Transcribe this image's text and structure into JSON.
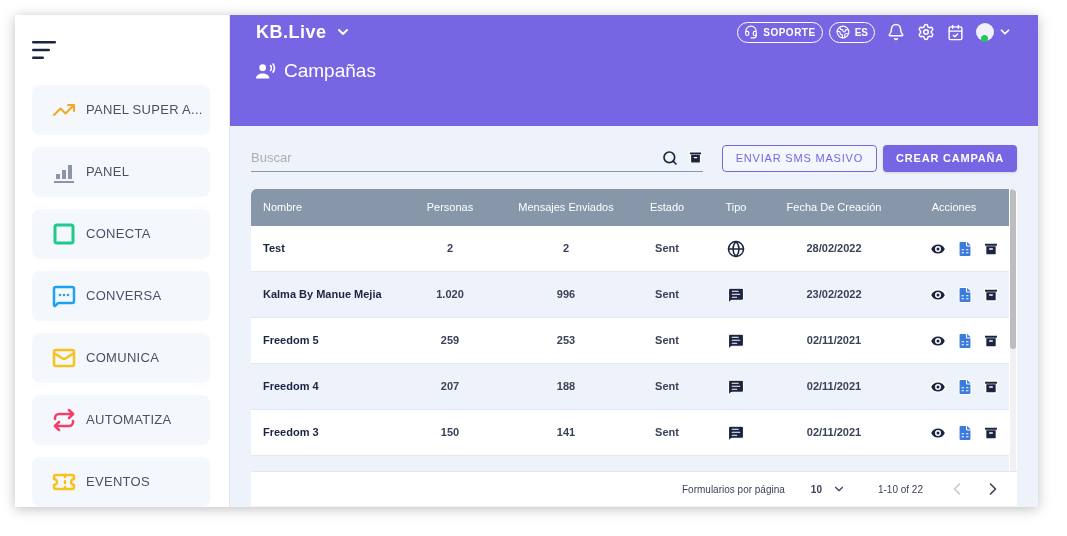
{
  "sidebar": {
    "items": [
      {
        "label": "PANEL SUPER A...",
        "kind": "trend"
      },
      {
        "label": "PANEL",
        "kind": "bars"
      },
      {
        "label": "CONECTA",
        "kind": "connect"
      },
      {
        "label": "CONVERSA",
        "kind": "chat"
      },
      {
        "label": "COMUNICA",
        "kind": "mail"
      },
      {
        "label": "AUTOMATIZA",
        "kind": "automate"
      },
      {
        "label": "EVENTOS",
        "kind": "ticket"
      }
    ]
  },
  "header": {
    "brand": "KB.Live",
    "support": "SOPORTE",
    "language": "ES",
    "page_title": "Campañas"
  },
  "toolbar": {
    "search_placeholder": "Buscar",
    "buttons": [
      {
        "label": "ENVIAR SMS MASIVO",
        "kind": "outline"
      },
      {
        "label": "CREAR CAMPAÑA",
        "kind": "filled"
      }
    ]
  },
  "table": {
    "columns": [
      "Nombre",
      "Personas",
      "Mensajes Enviados",
      "Estado",
      "Tipo",
      "Fecha De Creación",
      "Acciones"
    ],
    "rows": [
      {
        "name": "Test",
        "people": "2",
        "sent": "2",
        "status": "Sent",
        "kind": "web",
        "date": "28/02/2022"
      },
      {
        "name": "Kalma By Manue Mejia",
        "people": "1.020",
        "sent": "996",
        "status": "Sent",
        "kind": "sms",
        "date": "23/02/2022"
      },
      {
        "name": "Freedom 5",
        "people": "259",
        "sent": "253",
        "status": "Sent",
        "kind": "sms",
        "date": "02/11/2021"
      },
      {
        "name": "Freedom 4",
        "people": "207",
        "sent": "188",
        "status": "Sent",
        "kind": "sms",
        "date": "02/11/2021"
      },
      {
        "name": "Freedom 3",
        "people": "150",
        "sent": "141",
        "status": "Sent",
        "kind": "sms",
        "date": "02/11/2021"
      }
    ]
  },
  "pagination": {
    "label": "Formularios por página",
    "per_page": "10",
    "range": "1-10 of 22",
    "prev_disabled": true,
    "next_disabled": false
  }
}
